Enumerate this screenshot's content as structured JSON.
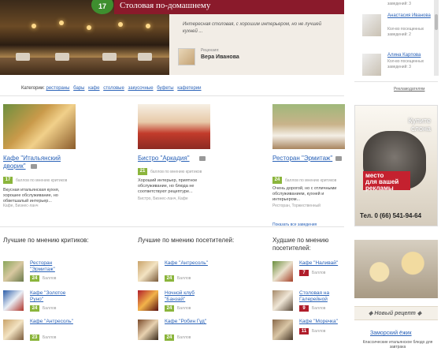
{
  "colors": {
    "accent": "#8a1a2b",
    "link": "#2b63b8",
    "rating_green": "#8bb53c",
    "rating_red": "#b01d2a",
    "badge_green": "#3e8f2f"
  },
  "hero": {
    "badge": "17",
    "title": "Столовая по-домашнему",
    "description": "Интересная столовая, с хорошим интерьером, но не лучшей кухней ...",
    "reviewer_label": "Рецензия:",
    "reviewer": "Вера Иванова"
  },
  "right_panel": {
    "top_meta": "заведений: 3",
    "users": [
      {
        "name": "Анастасия Иванова",
        "meta1": "Кол-во посещенных",
        "meta2": "заведений: 2"
      },
      {
        "name": "Алина Карпова",
        "meta1": "Кол-во посещенных",
        "meta2": "заведений: 3"
      }
    ],
    "advertisers_link": "Рекламодателям"
  },
  "categories": {
    "label": "Категории:",
    "items": [
      "рестораны",
      "бары",
      "кафе",
      "столовые",
      "закусочные",
      "буфеты",
      "кафетерии"
    ]
  },
  "featured": [
    {
      "title": "Кафе \"Итальянский дворик\"",
      "rating": "17",
      "rating_label": "баллов по мнению критиков",
      "desc": "Вкусная итальянская кухня, хорошее обслуживание, но обветшалый интерьер...",
      "tags": "Кафе, Бизнес-ланч"
    },
    {
      "title": "Бистро \"Аркадия\"",
      "rating": "21",
      "rating_label": "баллов по мнению критиков",
      "desc": "Хороший интерьер, приятное обслуживание, но блюда не соответствуют рецептуре...",
      "tags": "Бистро, Бизнес-ланч, Кафе"
    },
    {
      "title": "Ресторан \"Эрмитаж\"",
      "rating": "24",
      "rating_label": "баллов по мнению критиков",
      "desc": "Очень дорогой, но с отличными обслуживанием, кухней и интерьером...",
      "tags": "Ресторан, Торжественный"
    }
  ],
  "show_all_label": "Показать все заведения",
  "ad": {
    "text_line1": "Купите",
    "text_line2": "слона",
    "box_line1": "место",
    "box_line2": "для вашей",
    "box_line3": "рекламы",
    "phone": "Тел. 0 (66) 541-94-64"
  },
  "lists": [
    {
      "heading": "Лучшие по мнению критиков:",
      "items": [
        {
          "name": "Ресторан \"Эрмитаж\"",
          "score": "24",
          "label": "Баллов"
        },
        {
          "name": "Кафе \"Золотое Руно\"",
          "score": "24",
          "label": "Баллов"
        },
        {
          "name": "Кафе \"Антресоль\"",
          "score": "23",
          "label": "Баллов"
        }
      ]
    },
    {
      "heading": "Лучшие по мнению посетителей:",
      "items": [
        {
          "name": "Кафе \"Антресоль\"",
          "score": "24",
          "label": "Баллов"
        },
        {
          "name": "Ночной клуб \"Банзай\"",
          "score": "24",
          "label": "Баллов"
        },
        {
          "name": "Кафе \"Робин Гуд\"",
          "score": "24",
          "label": "Баллов"
        }
      ]
    },
    {
      "heading": "Худшие по мнению посетителей:",
      "items": [
        {
          "name": "Кафе \"Наливай\"",
          "score": "7",
          "label": "Баллов"
        },
        {
          "name": "Столовая на Галерейной",
          "score": "9",
          "label": "Баллов"
        },
        {
          "name": "Кафе \"Моречка\"",
          "score": "11",
          "label": "Баллов"
        }
      ]
    }
  ],
  "recipe": {
    "label": "Новый рецепт",
    "name": "Заморский ёжик",
    "desc": "Классические итальянское блюдо для завтрака"
  }
}
